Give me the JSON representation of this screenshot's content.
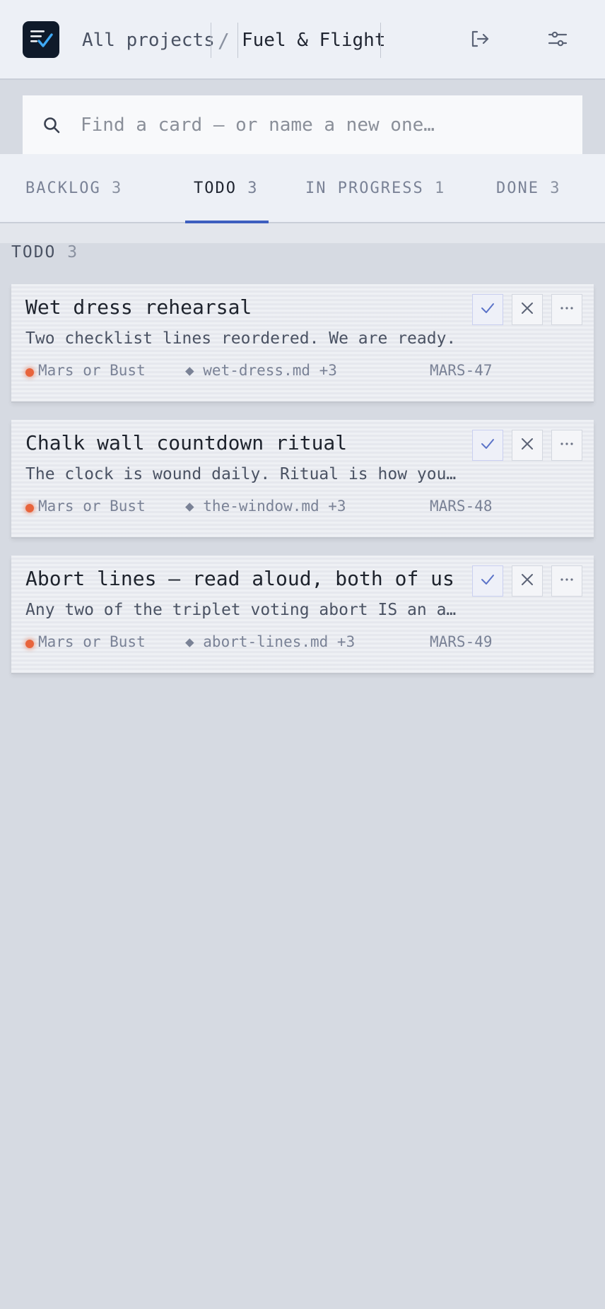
{
  "header": {
    "breadcrumb_all": "All projects",
    "breadcrumb_separator": "/",
    "breadcrumb_project": "Fuel & Flight",
    "logo_icon": "checklist-icon",
    "logout_icon": "logout-icon",
    "settings_icon": "sliders-icon"
  },
  "search": {
    "placeholder": "Find a card — or name a new one…",
    "value": ""
  },
  "tabs": [
    {
      "label": "BACKLOG",
      "count": "3",
      "active": false
    },
    {
      "label": "TODO",
      "count": "3",
      "active": true
    },
    {
      "label": "IN PROGRESS",
      "count": "1",
      "active": false
    },
    {
      "label": "DONE",
      "count": "3",
      "active": false
    }
  ],
  "column": {
    "title": "TODO",
    "count": "3"
  },
  "cards": [
    {
      "title": "Wet dress rehearsal",
      "description": "Two checklist lines reordered. We are ready.",
      "project": "Mars or Bust",
      "file": "◆ wet-dress.md +3",
      "id": "MARS-47"
    },
    {
      "title": "Chalk wall countdown ritual",
      "description": "The clock is wound daily. Ritual is how you…",
      "project": "Mars or Bust",
      "file": "◆ the-window.md +3",
      "id": "MARS-48"
    },
    {
      "title": "Abort lines — read aloud, both of us",
      "description": "Any two of the triplet voting abort IS an a…",
      "project": "Mars or Bust",
      "file": "◆ abort-lines.md +3",
      "id": "MARS-49"
    }
  ],
  "colors": {
    "accent": "#3d5fbf",
    "project_dot": "#e8643c",
    "background": "#d6dae2",
    "header_bg": "#edf0f6"
  }
}
